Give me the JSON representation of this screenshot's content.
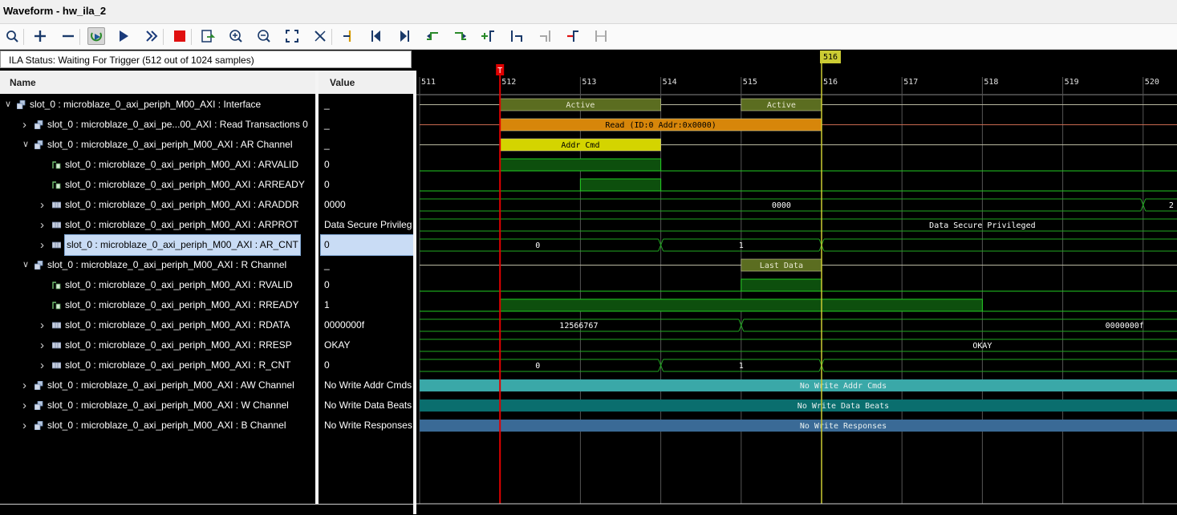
{
  "window": {
    "title": "Waveform - hw_ila_2"
  },
  "toolbar": {
    "buttons": [
      {
        "name": "search-button",
        "icon": "magnifier-icon"
      },
      {
        "name": "add-button",
        "icon": "plus-icon"
      },
      {
        "name": "remove-button",
        "icon": "minus-icon"
      },
      {
        "name": "auto-retrigger-button",
        "icon": "retrigger-icon",
        "pressed": true
      },
      {
        "name": "run-trigger-button",
        "icon": "play-icon"
      },
      {
        "name": "run-immediate-button",
        "icon": "fast-forward-icon"
      },
      {
        "name": "stop-button",
        "icon": "stop-icon"
      },
      {
        "name": "export-button",
        "icon": "export-icon"
      },
      {
        "name": "zoom-in-button",
        "icon": "zoom-in-icon"
      },
      {
        "name": "zoom-out-button",
        "icon": "zoom-out-icon"
      },
      {
        "name": "zoom-fit-button",
        "icon": "zoom-fit-icon"
      },
      {
        "name": "cursor-button",
        "icon": "cursor-icon"
      },
      {
        "name": "add-marker-button",
        "icon": "marker-icon"
      },
      {
        "name": "go-to-start-button",
        "icon": "go-start-icon"
      },
      {
        "name": "go-to-end-button",
        "icon": "go-end-icon"
      },
      {
        "name": "prev-transition-button",
        "icon": "prev-transition-icon"
      },
      {
        "name": "next-transition-button",
        "icon": "next-transition-icon"
      },
      {
        "name": "add-marker-2-button",
        "icon": "add-marker-icon"
      },
      {
        "name": "prev-marker-button",
        "icon": "prev-marker-icon"
      },
      {
        "name": "next-marker-button",
        "icon": "next-marker-icon",
        "disabled": true
      },
      {
        "name": "swap-cursors-button",
        "icon": "swap-cursor-icon"
      },
      {
        "name": "cursor-range-button",
        "icon": "range-icon",
        "disabled": true
      }
    ]
  },
  "status": {
    "text": "ILA Status:  Waiting For Trigger (512 out of 1024 samples)"
  },
  "columns": {
    "name": "Name",
    "value": "Value"
  },
  "signals": [
    {
      "name": "slot_0 : microblaze_0_axi_periph_M00_AXI : Interface",
      "value": "_",
      "indent": 0,
      "expander": "expanded",
      "icon": "interface-icon"
    },
    {
      "name": "slot_0 : microblaze_0_axi_pe...00_AXI : Read Transactions 0",
      "value": "_",
      "indent": 1,
      "expander": "collapsed",
      "icon": "interface-icon"
    },
    {
      "name": "slot_0 : microblaze_0_axi_periph_M00_AXI : AR Channel",
      "value": "_",
      "indent": 1,
      "expander": "expanded",
      "icon": "interface-icon"
    },
    {
      "name": "slot_0 : microblaze_0_axi_periph_M00_AXI : ARVALID",
      "value": "0",
      "indent": 2,
      "expander": "none",
      "icon": "bit-icon"
    },
    {
      "name": "slot_0 : microblaze_0_axi_periph_M00_AXI : ARREADY",
      "value": "0",
      "indent": 2,
      "expander": "none",
      "icon": "bit-icon"
    },
    {
      "name": "slot_0 : microblaze_0_axi_periph_M00_AXI : ARADDR",
      "value": "0000",
      "indent": 2,
      "expander": "collapsed",
      "icon": "bus-icon"
    },
    {
      "name": "slot_0 : microblaze_0_axi_periph_M00_AXI : ARPROT",
      "value": "Data Secure Privileg",
      "indent": 2,
      "expander": "collapsed",
      "icon": "bus-icon"
    },
    {
      "name": "slot_0 : microblaze_0_axi_periph_M00_AXI : AR_CNT",
      "value": "0",
      "indent": 2,
      "expander": "collapsed",
      "icon": "bus-icon",
      "selected": true
    },
    {
      "name": "slot_0 : microblaze_0_axi_periph_M00_AXI : R Channel",
      "value": "_",
      "indent": 1,
      "expander": "expanded",
      "icon": "interface-icon"
    },
    {
      "name": "slot_0 : microblaze_0_axi_periph_M00_AXI : RVALID",
      "value": "0",
      "indent": 2,
      "expander": "none",
      "icon": "bit-icon"
    },
    {
      "name": "slot_0 : microblaze_0_axi_periph_M00_AXI : RREADY",
      "value": "1",
      "indent": 2,
      "expander": "none",
      "icon": "bit-icon"
    },
    {
      "name": "slot_0 : microblaze_0_axi_periph_M00_AXI : RDATA",
      "value": "0000000f",
      "indent": 2,
      "expander": "collapsed",
      "icon": "bus-icon"
    },
    {
      "name": "slot_0 : microblaze_0_axi_periph_M00_AXI : RRESP",
      "value": "OKAY",
      "indent": 2,
      "expander": "collapsed",
      "icon": "bus-icon"
    },
    {
      "name": "slot_0 : microblaze_0_axi_periph_M00_AXI : R_CNT",
      "value": "0",
      "indent": 2,
      "expander": "collapsed",
      "icon": "bus-icon"
    },
    {
      "name": "slot_0 : microblaze_0_axi_periph_M00_AXI : AW Channel",
      "value": "No Write Addr Cmds",
      "indent": 1,
      "expander": "collapsed",
      "icon": "interface-icon"
    },
    {
      "name": "slot_0 : microblaze_0_axi_periph_M00_AXI : W Channel",
      "value": "No Write Data Beats",
      "indent": 1,
      "expander": "collapsed",
      "icon": "interface-icon"
    },
    {
      "name": "slot_0 : microblaze_0_axi_periph_M00_AXI : B Channel",
      "value": "No Write Responses",
      "indent": 1,
      "expander": "collapsed",
      "icon": "interface-icon"
    }
  ],
  "timeline": {
    "start": 511,
    "end": 520.45,
    "tick_labels": [
      "511",
      "512",
      "513",
      "514",
      "515",
      "516",
      "517",
      "518",
      "519",
      "520"
    ],
    "trigger_marker": {
      "sample": 512,
      "label": "T",
      "color": "#e00000"
    },
    "cursor": {
      "sample": 516,
      "label": "516",
      "color": "#cccc33"
    }
  },
  "waveforms": [
    {
      "type": "txn",
      "segments": [
        {
          "from": 512,
          "to": 514,
          "label": "Active",
          "color": "#5b6d20"
        },
        {
          "from": 515,
          "to": 516,
          "label": "Active",
          "color": "#5b6d20"
        }
      ],
      "base": "#b8b8a0"
    },
    {
      "type": "txn",
      "segments": [
        {
          "from": 512,
          "to": 516,
          "label": "Read (ID:0 Addr:0x0000)",
          "color": "#d7860a"
        }
      ],
      "base": "#c86a50"
    },
    {
      "type": "txn",
      "segments": [
        {
          "from": 512,
          "to": 514,
          "label": "Addr Cmd",
          "color": "#d4d400"
        }
      ],
      "base": "#b8b8a0"
    },
    {
      "type": "bit",
      "highs": [
        [
          512,
          514
        ]
      ]
    },
    {
      "type": "bit",
      "highs": [
        [
          513,
          514
        ]
      ]
    },
    {
      "type": "bus",
      "transitions": [
        520
      ],
      "labels": [
        {
          "at": 515.5,
          "text": "0000"
        },
        {
          "at": 520.35,
          "text": "2"
        }
      ]
    },
    {
      "type": "bus",
      "transitions": [],
      "labels": [
        {
          "at": 518,
          "text": "Data Secure Privileged"
        }
      ]
    },
    {
      "type": "bus",
      "transitions": [
        514,
        516
      ],
      "labels": [
        {
          "at": 512.47,
          "text": "0"
        },
        {
          "at": 515,
          "text": "1"
        }
      ]
    },
    {
      "type": "txn",
      "segments": [
        {
          "from": 515,
          "to": 516,
          "label": "Last Data",
          "color": "#5b6d20"
        }
      ],
      "base": "#b8b8a0"
    },
    {
      "type": "bit",
      "highs": [
        [
          515,
          516
        ]
      ]
    },
    {
      "type": "bit",
      "highs": [
        [
          512,
          518
        ]
      ]
    },
    {
      "type": "bus",
      "transitions": [
        515
      ],
      "labels": [
        {
          "at": 512.98,
          "text": "12566767"
        },
        {
          "at": 519.77,
          "text": "0000000f"
        }
      ]
    },
    {
      "type": "bus",
      "transitions": [],
      "labels": [
        {
          "at": 518,
          "text": "OKAY"
        }
      ]
    },
    {
      "type": "bus",
      "transitions": [
        514,
        516
      ],
      "labels": [
        {
          "at": 512.47,
          "text": "0"
        },
        {
          "at": 515,
          "text": "1"
        }
      ]
    },
    {
      "type": "fill",
      "label": "No Write Addr Cmds",
      "color": "#3aa8a8"
    },
    {
      "type": "fill",
      "label": "No Write Data Beats",
      "color": "#0a6e6e"
    },
    {
      "type": "fill",
      "label": "No Write Responses",
      "color": "#3a6a96"
    }
  ],
  "colors": {
    "bus_line": "#22aa22",
    "bit_fill": "#0d4f0d",
    "bit_line": "#22cc22",
    "grid": "#555555",
    "wave_text": "#ffffff"
  }
}
